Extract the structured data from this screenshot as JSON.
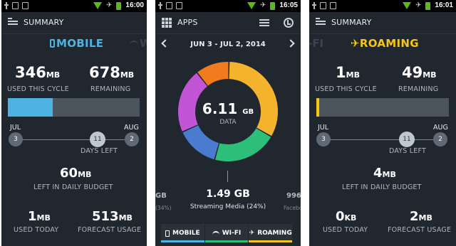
{
  "colors": {
    "mobile": "#4cb3e3",
    "wifi": "#2dbf7a",
    "roaming": "#f5c518",
    "donut": [
      "#f4b32c",
      "#2dbf7a",
      "#4a7bd0",
      "#c155d6",
      "#f07c1d"
    ]
  },
  "statusbar": {
    "times": [
      "16:00",
      "16:05",
      "16:01"
    ]
  },
  "mobile": {
    "appbar_title": "SUMMARY",
    "network_title": "MOBILE",
    "ghost_next": "W",
    "used_value": "346",
    "used_unit": "MB",
    "used_label": "USED THIS CYCLE",
    "remaining_value": "678",
    "remaining_unit": "MB",
    "remaining_label": "REMAINING",
    "usage_fraction": 0.34,
    "start_month": "JUL",
    "end_month": "AUG",
    "start_day": "3",
    "mid_day": "11",
    "end_day": "2",
    "days_left_label": "DAYS LEFT",
    "daily_value": "60",
    "daily_unit": "MB",
    "daily_label": "LEFT IN DAILY BUDGET",
    "today_value": "1",
    "today_unit": "MB",
    "today_label": "USED TODAY",
    "forecast_value": "513",
    "forecast_unit": "MB",
    "forecast_label": "FORECAST USAGE"
  },
  "apps": {
    "appbar_title": "APPS",
    "date_range": "JUN 3 - JUL 2, 2014",
    "total_value": "6.11",
    "total_unit": "GB",
    "total_label": "DATA",
    "donut_percent": [
      0.33,
      0.21,
      0.14,
      0.21,
      0.11
    ],
    "main_value": "1.49 GB",
    "main_label": "Streaming Media (24%)",
    "left_value": "GB",
    "left_sub": "(34%)",
    "right_value": "996",
    "right_sub": "Facebo",
    "tabs": [
      {
        "label": "MOBILE",
        "icon": "phone-icon"
      },
      {
        "label": "WI-FI",
        "icon": "wifi-icon"
      },
      {
        "label": "ROAMING",
        "icon": "plane-icon"
      }
    ]
  },
  "roaming": {
    "appbar_title": "SUMMARY",
    "network_title": "ROAMING",
    "ghost_prev": "-FI",
    "used_value": "1",
    "used_unit": "MB",
    "used_label": "USED THIS CYCLE",
    "remaining_value": "49",
    "remaining_unit": "MB",
    "remaining_label": "REMAINING",
    "usage_fraction": 0.02,
    "start_month": "JUL",
    "end_month": "AUG",
    "start_day": "3",
    "mid_day": "11",
    "end_day": "2",
    "days_left_label": "DAYS LEFT",
    "daily_value": "4",
    "daily_unit": "MB",
    "daily_label": "LEFT IN DAILY BUDGET",
    "today_value": "0",
    "today_unit": "KB",
    "today_label": "USED TODAY",
    "forecast_value": "2",
    "forecast_unit": "MB",
    "forecast_label": "FORECAST USAGE"
  }
}
